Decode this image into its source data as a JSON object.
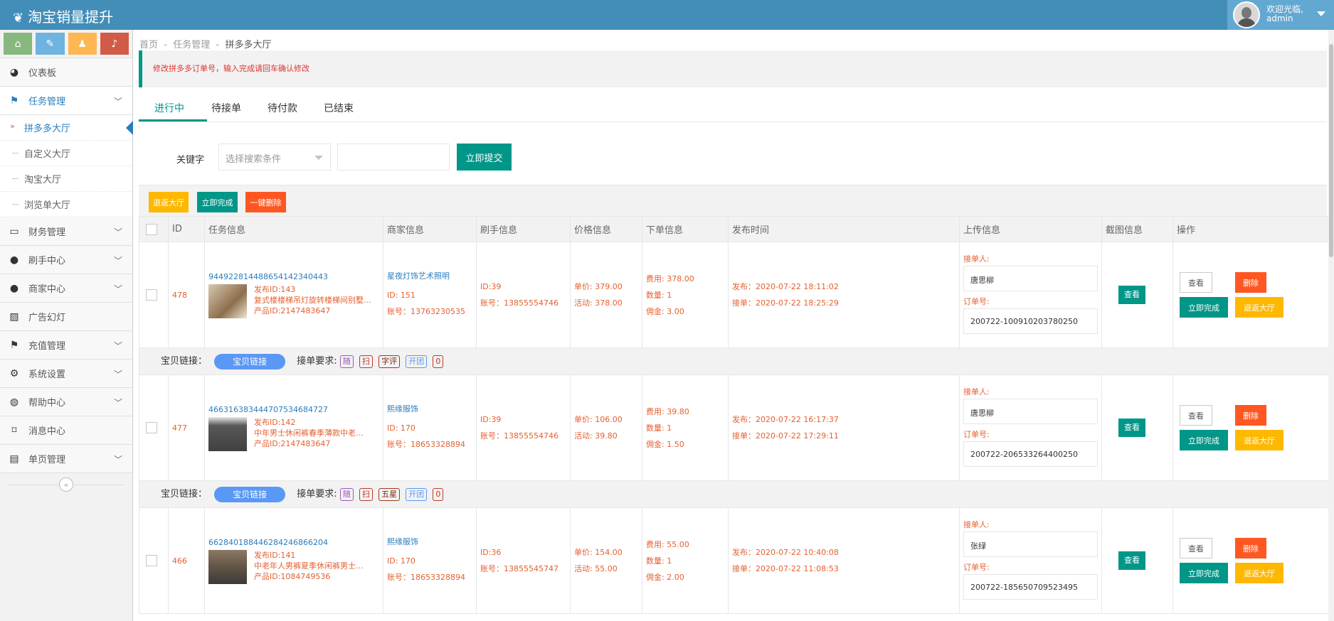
{
  "app": {
    "title": "淘宝销量提升",
    "welcome": "欢迎光临,",
    "user": "admin"
  },
  "sidebar": {
    "shortcuts": [
      {
        "icon": "home-icon",
        "color": "#87b87f"
      },
      {
        "icon": "pencil-icon",
        "color": "#6fb3e0"
      },
      {
        "icon": "users-icon",
        "color": "#ffb752"
      },
      {
        "icon": "bell-icon",
        "color": "#d15b47"
      }
    ],
    "items": [
      {
        "label": "仪表板",
        "icon": "dashboard-icon"
      },
      {
        "label": "任务管理",
        "icon": "flag-icon",
        "sub": [
          "拼多多大厅",
          "自定义大厅",
          "淘宝大厅",
          "浏览单大厅"
        ]
      },
      {
        "label": "财务管理",
        "icon": "inbox-icon"
      },
      {
        "label": "刷手中心",
        "icon": "user-icon"
      },
      {
        "label": "商家中心",
        "icon": "user-icon"
      },
      {
        "label": "广告幻灯",
        "icon": "picture-icon"
      },
      {
        "label": "充值管理",
        "icon": "flag-icon"
      },
      {
        "label": "系统设置",
        "icon": "gear-icon"
      },
      {
        "label": "帮助中心",
        "icon": "globe-icon"
      },
      {
        "label": "消息中心",
        "icon": "bookmark-icon"
      },
      {
        "label": "单页管理",
        "icon": "book-icon"
      }
    ]
  },
  "breadcrumb": [
    "首页",
    "任务管理",
    "拼多多大厅"
  ],
  "alert": "修改拼多多订单号，输入完成请回车确认修改",
  "tabs": [
    "进行中",
    "待接单",
    "待付款",
    "已结束"
  ],
  "search": {
    "label": "关键字",
    "select_placeholder": "选择搜索条件",
    "submit": "立即提交"
  },
  "actions": {
    "back": "退返大厅",
    "complete": "立即完成",
    "delete": "一键删除"
  },
  "table": {
    "headers": [
      "ID",
      "任务信息",
      "商家信息",
      "刷手信息",
      "价格信息",
      "下单信息",
      "发布时间",
      "上传信息",
      "截图信息",
      "操作"
    ],
    "rows": [
      {
        "id": "478",
        "task_no": "9449228144886541423404 43",
        "task_no_full": "944922814488654142340443",
        "pub_id": "发布ID:143",
        "title": "复式楼楼梯吊灯旋转楼梯间别墅...",
        "prod_id": "产品ID:2147483647",
        "merchant": "星夜灯饰艺术照明",
        "m_id": "ID: 151",
        "m_acct": "账号：13763230535",
        "worker_id": "ID:39",
        "worker_acct": "账号：13855554746",
        "price": "单价: 379.00",
        "activity": "活动: 378.00",
        "fee": "费用: 378.00",
        "qty": "数量: 1",
        "commission": "佣金: 3.00",
        "published": "发布：2020-07-22 18:11:02",
        "accepted": "接单：2020-07-22 18:25:29",
        "receiver_label": "接单人:",
        "receiver": "唐思柳",
        "order_label": "订单号:",
        "order_no": "200722-100910203780250",
        "view": "查看",
        "op_view": "查看",
        "op_delete": "删除",
        "op_complete": "立即完成",
        "op_back": "退返大厅",
        "link_label": "宝贝链接：",
        "link_btn": "宝贝链接",
        "req_label": "接单要求:",
        "tags": [
          "随",
          "扫",
          "字评",
          "开团",
          "0"
        ]
      },
      {
        "id": "477",
        "task_no_full": "466316383444707534684727",
        "pub_id": "发布ID:142",
        "title": "中年男士休闲裤春季薄款中老...",
        "prod_id": "产品ID:2147483647",
        "merchant": "熙缘服饰",
        "m_id": "ID: 170",
        "m_acct": "账号：18653328894",
        "worker_id": "ID:39",
        "worker_acct": "账号：13855554746",
        "price": "单价: 106.00",
        "activity": "活动: 39.80",
        "fee": "费用: 39.80",
        "qty": "数量: 1",
        "commission": "佣金: 1.50",
        "published": "发布：2020-07-22 16:17:37",
        "accepted": "接单：2020-07-22 17:29:11",
        "receiver_label": "接单人:",
        "receiver": "唐思柳",
        "order_label": "订单号:",
        "order_no": "200722-206533264400250",
        "view": "查看",
        "op_view": "查看",
        "op_delete": "删除",
        "op_complete": "立即完成",
        "op_back": "退返大厅",
        "link_label": "宝贝链接：",
        "link_btn": "宝贝链接",
        "req_label": "接单要求:",
        "tags": [
          "随",
          "扫",
          "五星",
          "开团",
          "0"
        ]
      },
      {
        "id": "466",
        "task_no_full": "662840188446284246866204",
        "pub_id": "发布ID:141",
        "title": "中老年人男裤夏季休闲裤男士...",
        "prod_id": "产品ID:1084749536",
        "merchant": "熙缘服饰",
        "m_id": "ID: 170",
        "m_acct": "账号：18653328894",
        "worker_id": "ID:36",
        "worker_acct": "账号：13855545747",
        "price": "单价: 154.00",
        "activity": "活动: 55.00",
        "fee": "费用: 55.00",
        "qty": "数量: 1",
        "commission": "佣金: 2.00",
        "published": "发布：2020-07-22 10:40:08",
        "accepted": "接单：2020-07-22 11:08:53",
        "receiver_label": "接单人:",
        "receiver": "张绿",
        "order_label": "订单号:",
        "order_no": "200722-185650709523495",
        "view": "查看",
        "op_view": "查看",
        "op_delete": "删除",
        "op_complete": "立即完成",
        "op_back": "退返大厅"
      }
    ]
  },
  "colors": {
    "topbar": "#438eb9",
    "accent_green": "#009688",
    "accent_orange": "#ffb800",
    "accent_red": "#ff5722",
    "link_blue": "#2b7dbc",
    "value_orange": "#e56030"
  }
}
